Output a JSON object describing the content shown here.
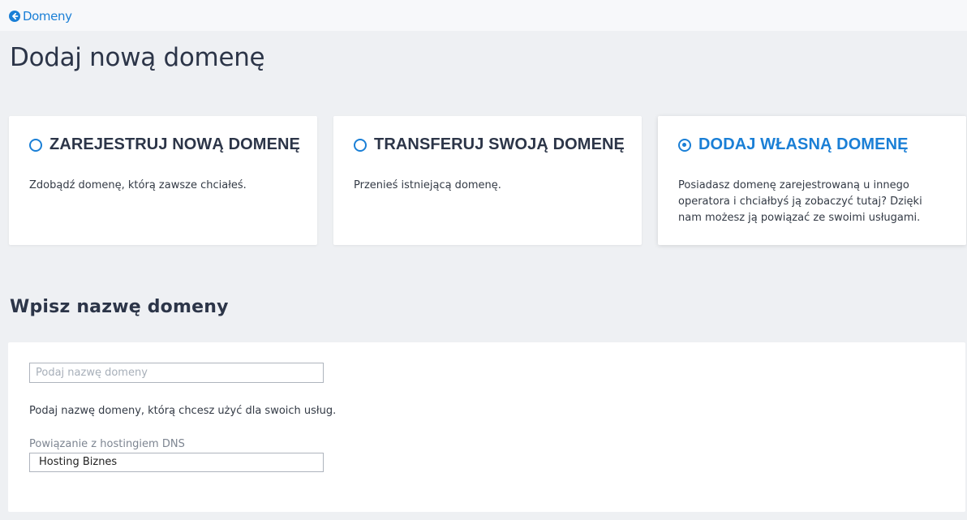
{
  "nav": {
    "back_label": "Domeny",
    "back_icon": "arrow-circle-left-icon"
  },
  "page": {
    "title": "Dodaj nową domenę"
  },
  "options": [
    {
      "title": "ZAREJESTRUJ NOWĄ DOMENĘ",
      "description": "Zdobądź domenę, którą zawsze chciałeś.",
      "selected": false
    },
    {
      "title": "TRANSFERUJ SWOJĄ DOMENĘ",
      "description": "Przenieś istniejącą domenę.",
      "selected": false
    },
    {
      "title": "DODAJ WŁASNĄ DOMENĘ",
      "description": "Posiadasz domenę zarejestrowaną u innego operatora i chciałbyś ją zobaczyć tutaj? Dzięki nam możesz ją powiązać ze swoimi usługami.",
      "selected": true
    }
  ],
  "form": {
    "section_title": "Wpisz nazwę domeny",
    "domain_input": {
      "value": "",
      "placeholder": "Podaj nazwę domeny"
    },
    "help_text": "Podaj nazwę domeny, którą chcesz użyć dla swoich usług.",
    "dns_label": "Powiązanie z hostingiem DNS",
    "dns_value": "Hosting Biznes"
  },
  "colors": {
    "accent": "#1a7fd6",
    "background": "#eef0f3",
    "heading": "#2c3548"
  }
}
